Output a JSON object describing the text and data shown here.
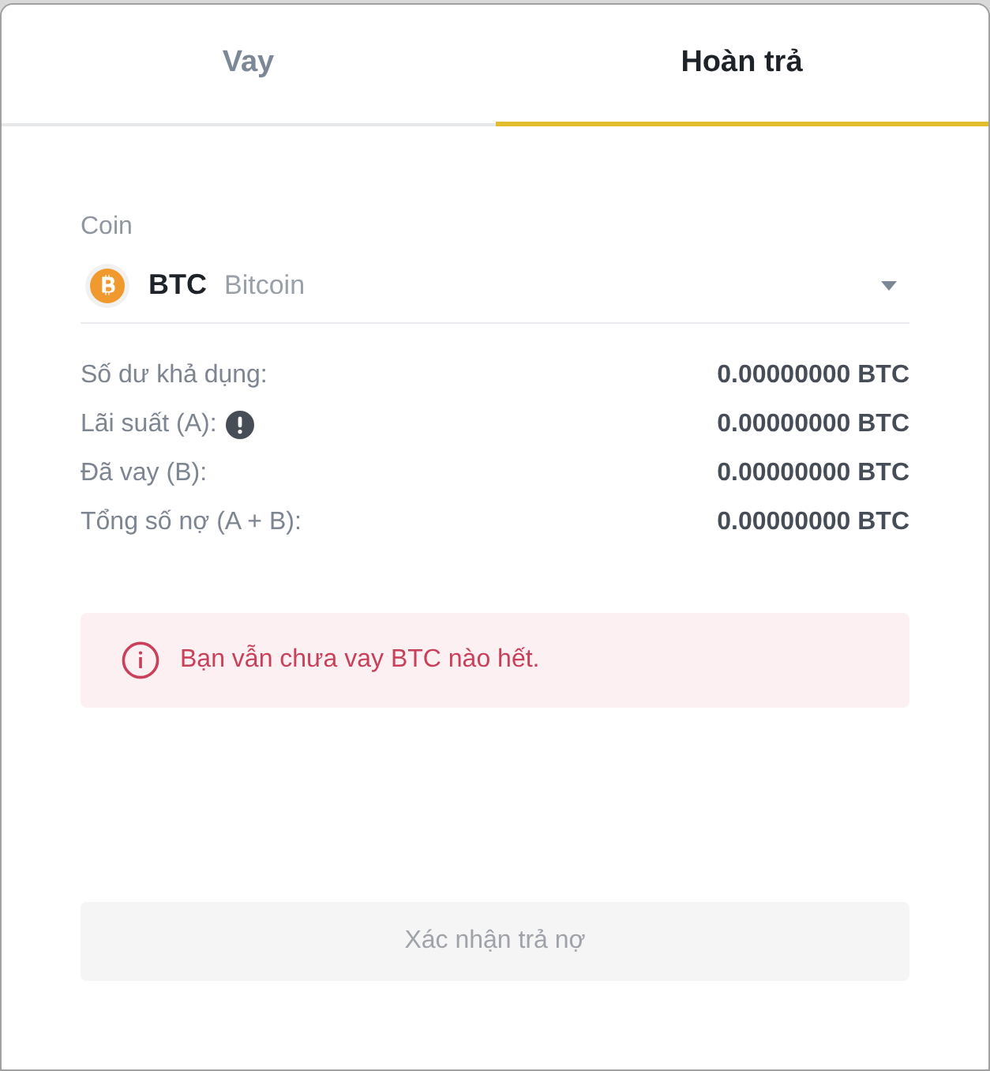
{
  "tabs": [
    {
      "label": "Vay",
      "selected": false
    },
    {
      "label": "Hoàn trả",
      "selected": true
    }
  ],
  "coin_select": {
    "label": "Coin",
    "symbol": "BTC",
    "name": "Bitcoin"
  },
  "summary": [
    {
      "label": "Số dư khả dụng:",
      "value": "0.00000000 BTC",
      "info": false
    },
    {
      "label": "Lãi suất (A):",
      "value": "0.00000000 BTC",
      "info": true
    },
    {
      "label": "Đã vay (B):",
      "value": "0.00000000 BTC",
      "info": false
    },
    {
      "label": "Tổng số nợ (A + B):",
      "value": "0.00000000 BTC",
      "info": false
    }
  ],
  "alert": {
    "message": "Bạn vẫn chưa vay BTC nào hết."
  },
  "confirm_button": {
    "label": "Xác nhận trả nợ",
    "disabled": true
  }
}
